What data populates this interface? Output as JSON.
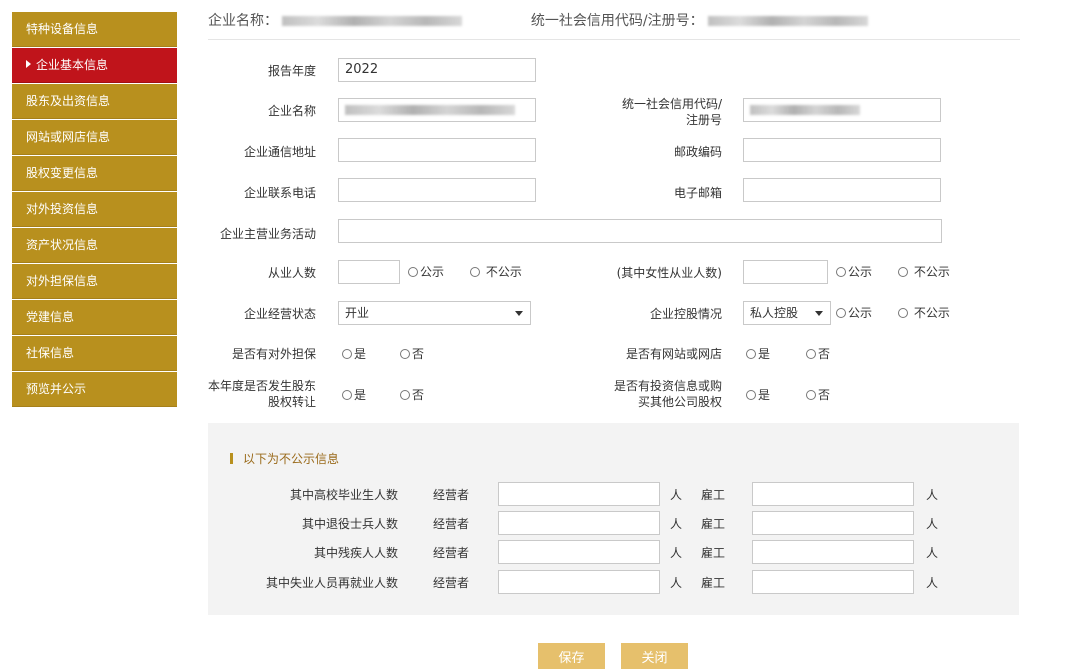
{
  "sidebar": {
    "items": [
      {
        "label": "特种设备信息",
        "active": false
      },
      {
        "label": "企业基本信息",
        "active": true
      },
      {
        "label": "股东及出资信息",
        "active": false
      },
      {
        "label": "网站或网店信息",
        "active": false
      },
      {
        "label": "股权变更信息",
        "active": false
      },
      {
        "label": "对外投资信息",
        "active": false
      },
      {
        "label": "资产状况信息",
        "active": false
      },
      {
        "label": "对外担保信息",
        "active": false
      },
      {
        "label": "党建信息",
        "active": false
      },
      {
        "label": "社保信息",
        "active": false
      },
      {
        "label": "预览并公示",
        "active": false
      }
    ]
  },
  "header": {
    "company_name_label": "企业名称：",
    "credit_code_label": "统一社会信用代码/注册号："
  },
  "form": {
    "report_year": {
      "label": "报告年度",
      "value": "2022"
    },
    "company_name": {
      "label": "企业名称"
    },
    "credit_code": {
      "label_line1": "统一社会信用代码/",
      "label_line2": "注册号"
    },
    "address": {
      "label": "企业通信地址",
      "value": ""
    },
    "postcode": {
      "label": "邮政编码",
      "value": ""
    },
    "phone": {
      "label": "企业联系电话",
      "value": ""
    },
    "email": {
      "label": "电子邮箱",
      "value": ""
    },
    "main_business": {
      "label": "企业主营业务活动",
      "value": ""
    },
    "employees": {
      "label": "从业人数",
      "value": "",
      "public": "公示",
      "not_public": "不公示"
    },
    "female_employees": {
      "label": "(其中女性从业人数)",
      "value": "",
      "public": "公示",
      "not_public": "不公示"
    },
    "status": {
      "label": "企业经营状态",
      "selected": "开业"
    },
    "holding": {
      "label": "企业控股情况",
      "selected": "私人控股",
      "public": "公示",
      "not_public": "不公示"
    },
    "guarantee": {
      "label": "是否有对外担保",
      "yes": "是",
      "no": "否"
    },
    "website": {
      "label": "是否有网站或网店",
      "yes": "是",
      "no": "否"
    },
    "equity_transfer": {
      "label_line1": "本年度是否发生股东",
      "label_line2": "股权转让",
      "yes": "是",
      "no": "否"
    },
    "investment": {
      "label_line1": "是否有投资信息或购",
      "label_line2": "买其他公司股权",
      "yes": "是",
      "no": "否"
    }
  },
  "private_section": {
    "title": "以下为不公示信息",
    "operator_label": "经营者",
    "employee_label": "雇工",
    "unit": "人",
    "rows": [
      {
        "label": "其中高校毕业生人数"
      },
      {
        "label": "其中退役士兵人数"
      },
      {
        "label": "其中残疾人人数"
      },
      {
        "label": "其中失业人员再就业人数"
      }
    ]
  },
  "buttons": {
    "save": "保存",
    "close": "关闭"
  },
  "colors": {
    "sidebar_bg": "#b8901e",
    "sidebar_active": "#c0141b",
    "button_bg": "#e6c06c",
    "section_bg": "#f3f3f3"
  }
}
